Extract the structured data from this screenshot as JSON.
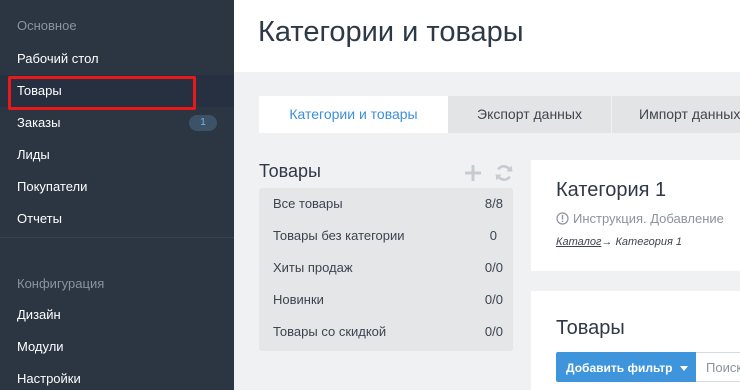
{
  "sidebar": {
    "section_main": "Основное",
    "items_main": [
      {
        "label": "Рабочий стол"
      },
      {
        "label": "Товары"
      },
      {
        "label": "Заказы",
        "badge": "1"
      },
      {
        "label": "Лиды"
      },
      {
        "label": "Покупатели"
      },
      {
        "label": "Отчеты"
      }
    ],
    "section_config": "Конфигурация",
    "items_config": [
      {
        "label": "Дизайн"
      },
      {
        "label": "Модули"
      },
      {
        "label": "Настройки"
      }
    ]
  },
  "header": {
    "title": "Категории и товары"
  },
  "tabs": [
    {
      "label": "Категории и товары",
      "active": true
    },
    {
      "label": "Экспорт данных",
      "active": false
    },
    {
      "label": "Импорт данных",
      "active": false
    }
  ],
  "products_panel": {
    "title": "Товары",
    "add_icon": "plus-icon",
    "refresh_icon": "refresh-icon",
    "categories": [
      {
        "name": "Все товары",
        "count": "8/8"
      },
      {
        "name": "Товары без категории",
        "count": "0"
      },
      {
        "name": "Хиты продаж",
        "count": "0/0"
      },
      {
        "name": "Новинки",
        "count": "0/0"
      },
      {
        "name": "Товары со скидкой",
        "count": "0/0"
      }
    ]
  },
  "category_card": {
    "title": "Категория 1",
    "info_icon": "info-icon",
    "info_text": "Инструкция. Добавление",
    "breadcrumb_link": "Каталог",
    "breadcrumb_arrow": "→",
    "breadcrumb_current": " Категория 1"
  },
  "products_card": {
    "title": "Товары",
    "filter_button": "Добавить фильтр",
    "search_placeholder": "Поиск"
  },
  "colors": {
    "sidebar_bg": "#2c3542",
    "accent_blue": "#3f95dc",
    "highlight_red": "#e8191b",
    "badge_text": "#6fb7e6"
  }
}
